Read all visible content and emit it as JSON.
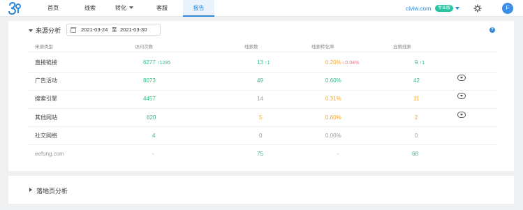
{
  "nav": {
    "items": [
      {
        "label": "首页"
      },
      {
        "label": "线索"
      },
      {
        "label": "转化"
      },
      {
        "label": "客服"
      },
      {
        "label": "报告"
      }
    ],
    "domain": "civiw.com",
    "badge": "专业版",
    "avatar_letter": "F"
  },
  "section1": {
    "title": "来源分析",
    "date_start": "2021-03-24",
    "date_sep": "至",
    "date_end": "2021-03-30",
    "help": "?"
  },
  "table": {
    "headers": [
      "来源类型",
      "访问次数",
      "线索数",
      "线索转化率",
      "合格线索"
    ],
    "rows": [
      {
        "type": "直接链接",
        "visits": "6277",
        "visits_delta": "↑1295",
        "leads": "13",
        "leads_delta": "↑1",
        "rate": "0.20%",
        "rate_delta": "↓0.04%",
        "qualified": "9",
        "qualified_delta": "↑1"
      },
      {
        "type": "广告活动",
        "visits": "8073",
        "leads": "49",
        "rate": "0.60%",
        "qualified": "42"
      },
      {
        "type": "搜索引擎",
        "visits": "4457",
        "leads": "14",
        "rate": "0.31%",
        "qualified": "11"
      },
      {
        "type": "其他网站",
        "visits": "820",
        "leads": "5",
        "rate": "0.60%",
        "qualified": "2"
      },
      {
        "type": "社交网络",
        "visits": "4",
        "leads": "0",
        "rate": "0.00%",
        "qualified": "0"
      },
      {
        "type": "eefung.com",
        "visits": "-",
        "leads": "75",
        "rate": "-",
        "qualified": "68"
      }
    ]
  },
  "section2": {
    "title": "落地页分析"
  },
  "colors": {
    "accent": "#2f87d8",
    "green": "#2fbf83",
    "orange": "#f5a623",
    "badge": "#29c3a2"
  }
}
